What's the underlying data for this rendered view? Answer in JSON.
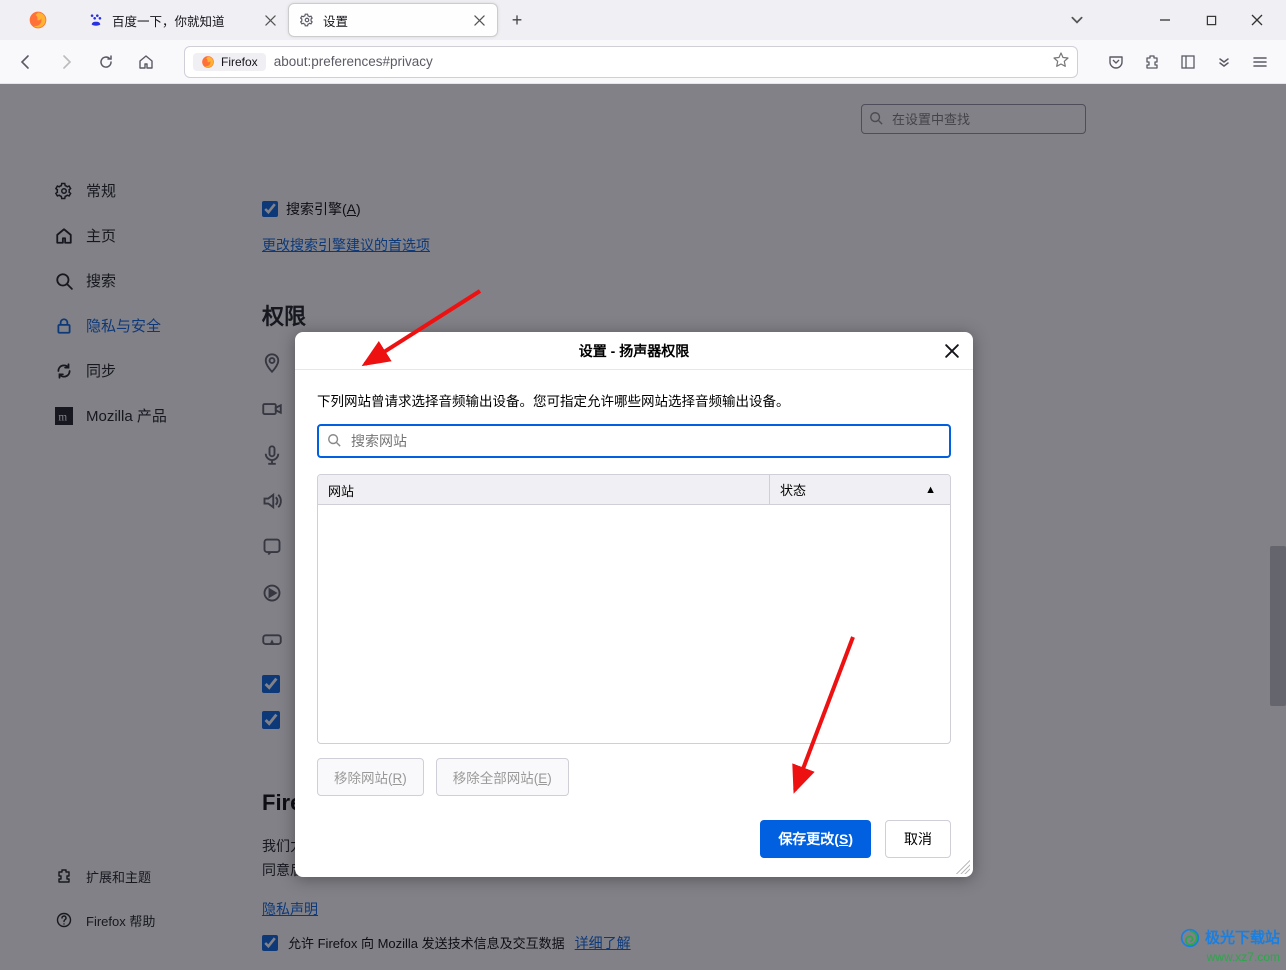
{
  "window": {
    "tabs": [
      {
        "label": "百度一下，你就知道"
      },
      {
        "label": "设置"
      }
    ]
  },
  "url": {
    "chip": "Firefox",
    "address": "about:preferences#privacy"
  },
  "search_settings": {
    "placeholder": "在设置中查找"
  },
  "sidebar": {
    "items": [
      {
        "label": "常规"
      },
      {
        "label": "主页"
      },
      {
        "label": "搜索"
      },
      {
        "label": "隐私与安全"
      },
      {
        "label": "同步"
      },
      {
        "label": "Mozilla 产品"
      }
    ],
    "bottom": [
      {
        "label": "扩展和主题"
      },
      {
        "label": "Firefox 帮助"
      }
    ]
  },
  "main": {
    "search_engine_checkbox": "搜索引擎(A)",
    "search_engine_link": "更改搜索引擎建议的首选项",
    "permissions_title": "权限",
    "data_title": "Firefox 数据收集与使用",
    "data_p1": "我们力图为您提供选择权，并保证只收集我们为众人提供和改进 Firefox 所需的信息。我们仅在征得您的同意后接收个人信息。",
    "privacy_notice": "隐私声明",
    "allow_tech": "允许 Firefox 向 Mozilla 发送技术信息及交互数据",
    "learn_more": "详细了解"
  },
  "dialog": {
    "title": "设置 - 扬声器权限",
    "desc": "下列网站曾请求选择音频输出设备。您可指定允许哪些网站选择音频输出设备。",
    "search_placeholder": "搜索网站",
    "col_site": "网站",
    "col_status": "状态",
    "remove_site": "移除网站(R)",
    "remove_all": "移除全部网站(E)",
    "save": "保存更改(S)",
    "cancel": "取消"
  },
  "watermark": {
    "cn": "极光下载站",
    "url": "www.xz7.com"
  }
}
